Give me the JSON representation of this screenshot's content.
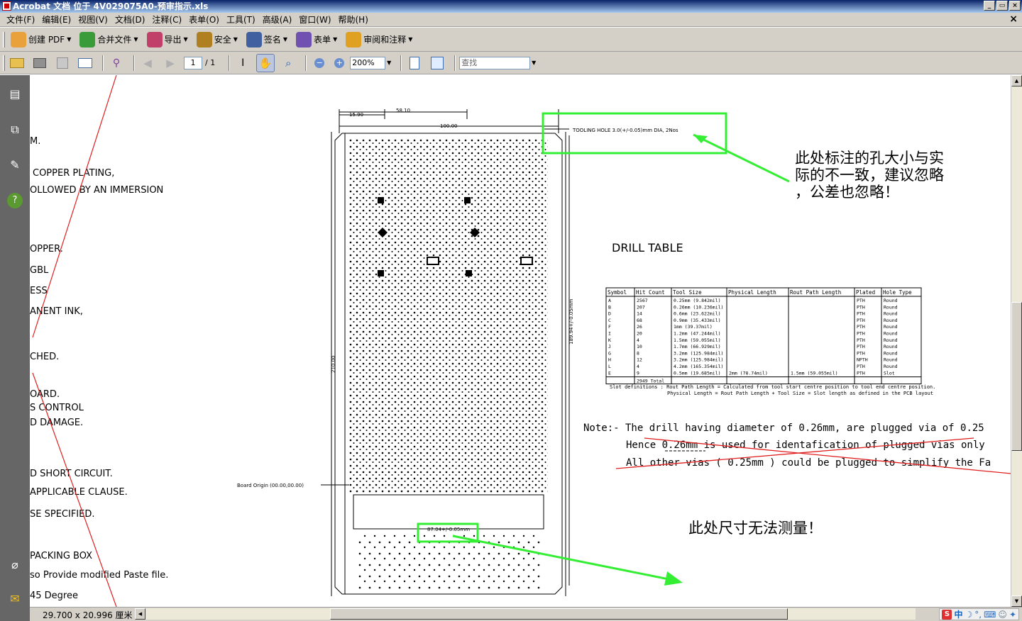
{
  "window": {
    "title": "Acrobat 文档 位于 4V029075A0-预审指示.xls",
    "controls": [
      "_",
      "▭",
      "×"
    ]
  },
  "menu": [
    "文件(F)",
    "编辑(E)",
    "视图(V)",
    "文档(D)",
    "注释(C)",
    "表单(O)",
    "工具(T)",
    "高级(A)",
    "窗口(W)",
    "帮助(H)"
  ],
  "toolbar1": [
    {
      "label": "创建 PDF",
      "icon": "create-pdf-icon",
      "color": "#e9a23b"
    },
    {
      "label": "合并文件",
      "icon": "combine-files-icon",
      "color": "#3a9b3a"
    },
    {
      "label": "导出",
      "icon": "export-icon",
      "color": "#c0406a"
    },
    {
      "label": "安全",
      "icon": "lock-icon",
      "color": "#b08020"
    },
    {
      "label": "签名",
      "icon": "pen-sign-icon",
      "color": "#4060a0"
    },
    {
      "label": "表单",
      "icon": "form-icon",
      "color": "#7050b0"
    },
    {
      "label": "审阅和注释",
      "icon": "comment-icon",
      "color": "#e0a020"
    }
  ],
  "toolbar2": {
    "page_current": "1",
    "page_total": "/ 1",
    "zoom": "200%",
    "find_placeholder": "查找"
  },
  "document": {
    "left_notes": [
      "M.",
      "COPPER PLATING,",
      "OLLOWED BY AN IMMERSION",
      "OPPER.",
      "GBL",
      "ESS",
      "ANENT INK,",
      "CHED.",
      "OARD.",
      "S CONTROL",
      "D DAMAGE.",
      "D SHORT CIRCUIT.",
      "APPLICABLE CLAUSE.",
      "SE SPECIFIED.",
      "PACKING BOX",
      "so Provide modified Paste file.",
      "45 Degree"
    ],
    "dims": {
      "d1": "15.90",
      "d2": "58.10",
      "d3": "100.00",
      "height": "210.00",
      "right": "189.94+/-0.05mm",
      "bottom": "87.04+/-0.05mm"
    },
    "tooling_hole": "TOOLING HOLE 3.0(+/-0.05)mm DIA, 2Nos",
    "board_origin": "Board Origin (00.00,00.00)",
    "annotation_top": [
      "此处标注的孔大小与实",
      "际的不一致，建议忽略",
      "，公差也忽略！"
    ],
    "annotation_bottom": "此处尺寸无法测量！",
    "drill_table": {
      "title": "DRILL TABLE",
      "headers": [
        "Symbol",
        "Hit Count",
        "Tool Size",
        "Physical Length",
        "Rout Path Length",
        "Plated",
        "Hole Type"
      ],
      "rows": [
        [
          "A",
          "2567",
          "0.25mm (9.842mil)",
          "",
          "",
          "PTH",
          "Round"
        ],
        [
          "B",
          "207",
          "0.26mm (10.236mil)",
          "",
          "",
          "PTH",
          "Round"
        ],
        [
          "D",
          "14",
          "0.6mm (23.622mil)",
          "",
          "",
          "PTH",
          "Round"
        ],
        [
          "C",
          "68",
          "0.9mm (35.433mil)",
          "",
          "",
          "PTH",
          "Round"
        ],
        [
          "F",
          "26",
          "1mm (39.37mil)",
          "",
          "",
          "PTH",
          "Round"
        ],
        [
          "I",
          "20",
          "1.2mm (47.244mil)",
          "",
          "",
          "PTH",
          "Round"
        ],
        [
          "K",
          "4",
          "1.5mm (59.055mil)",
          "",
          "",
          "PTH",
          "Round"
        ],
        [
          "J",
          "10",
          "1.7mm (66.929mil)",
          "",
          "",
          "PTH",
          "Round"
        ],
        [
          "G",
          "8",
          "3.2mm (125.984mil)",
          "",
          "",
          "PTH",
          "Round"
        ],
        [
          "H",
          "12",
          "3.2mm (125.984mil)",
          "",
          "",
          "NPTH",
          "Round"
        ],
        [
          "L",
          "4",
          "4.2mm (165.354mil)",
          "",
          "",
          "PTH",
          "Round"
        ],
        [
          "E",
          "9",
          "0.5mm (19.685mil)",
          "2mm (78.74mil)",
          "1.5mm (59.055mil)",
          "PTH",
          "Slot"
        ]
      ],
      "total": "2949 Total",
      "slot_def_1": "Slot definitions : Rout Path Length = Calculated from tool start centre position to tool end centre position.",
      "slot_def_2": "Physical Length = Rout Path Length + Tool Size = Slot length as defined in the PCB layout"
    },
    "note_line1": "Note:- The drill having diameter of 0.26mm, are plugged via of 0.25",
    "note_line2": "Hence 0.26mm is used for identafication of plugged vias only",
    "note_line3": "All other vias ( 0.25mm ) could be plugged to simplify the Fa"
  },
  "status": {
    "page_size": "29.700 x 20.996 厘米",
    "ime_label": "中"
  },
  "colors": {
    "highlight": "#33ee33",
    "markup_red": "#e02020",
    "chrome": "#d4d0c8",
    "nav_panel": "#666666"
  }
}
